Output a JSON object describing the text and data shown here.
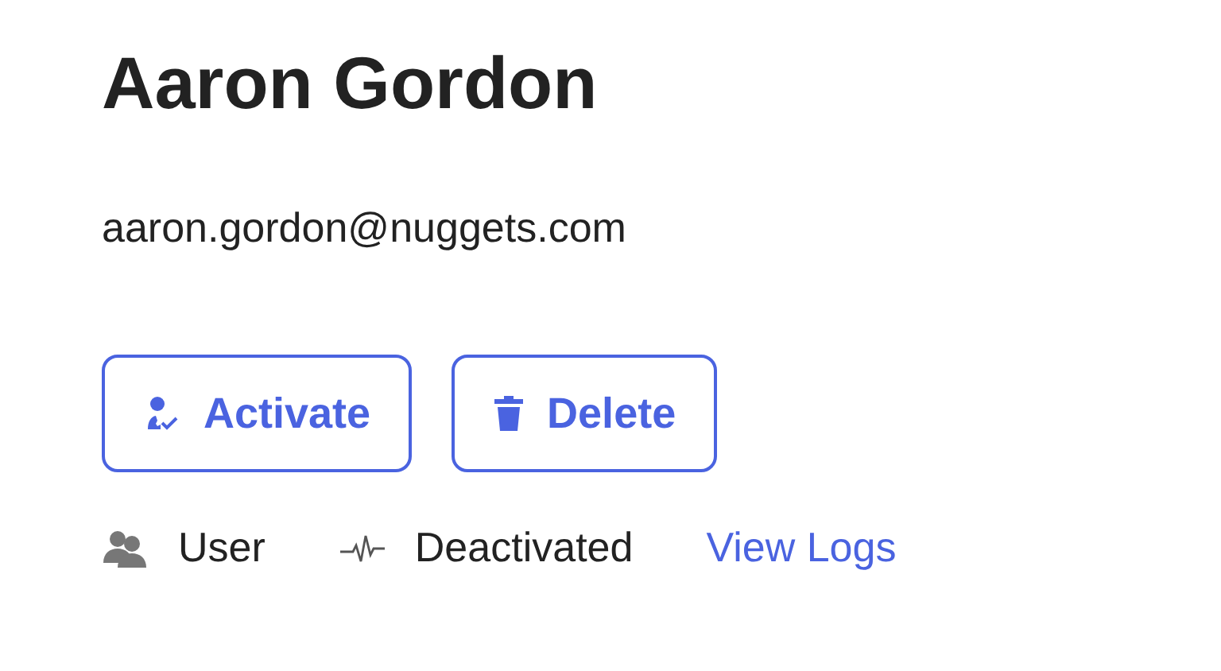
{
  "name": "Aaron Gordon",
  "email": "aaron.gordon@nuggets.com",
  "buttons": [
    {
      "kind": "activate",
      "label": "Activate"
    },
    {
      "kind": "delete",
      "label": "Delete"
    }
  ],
  "meta": [
    {
      "kind": "role",
      "label": "User"
    },
    {
      "kind": "status",
      "label": "Deactivated"
    },
    {
      "kind": "link",
      "label": "View Logs"
    }
  ]
}
